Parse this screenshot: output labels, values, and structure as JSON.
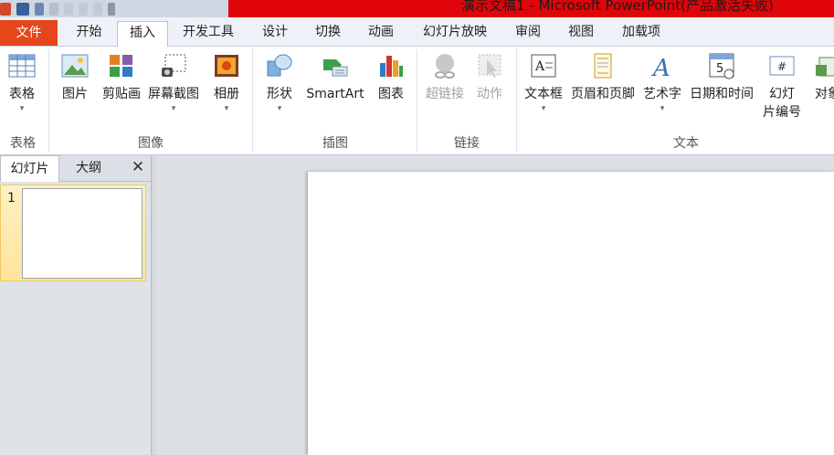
{
  "window": {
    "title": "演示文稿1 - Microsoft PowerPoint(产品激活失败)"
  },
  "tabs": [
    "文件",
    "开始",
    "插入",
    "开发工具",
    "设计",
    "切换",
    "动画",
    "幻灯片放映",
    "审阅",
    "视图",
    "加载项"
  ],
  "ribbon": {
    "groups": {
      "table": "表格",
      "images": "图像",
      "illustrations": "插图",
      "links": "链接",
      "text": "文本"
    },
    "buttons": {
      "table": "表格",
      "picture": "图片",
      "clipart": "剪贴画",
      "screenshot": "屏幕截图",
      "album": "相册",
      "shapes": "形状",
      "smartart": "SmartArt",
      "chart": "图表",
      "hyperlink": "超链接",
      "action": "动作",
      "textbox": "文本框",
      "header_footer": "页眉和页脚",
      "wordart": "艺术字",
      "datetime": "日期和时间",
      "slide_number_1": "幻灯",
      "slide_number_2": "片编号",
      "object": "对象"
    }
  },
  "left_pane": {
    "tabs": {
      "slides": "幻灯片",
      "outline": "大纲"
    },
    "close": "✕",
    "slide_numbers": [
      "1"
    ]
  },
  "colors": {
    "accent": "#e5461c",
    "title_bg": "#e0050a"
  }
}
